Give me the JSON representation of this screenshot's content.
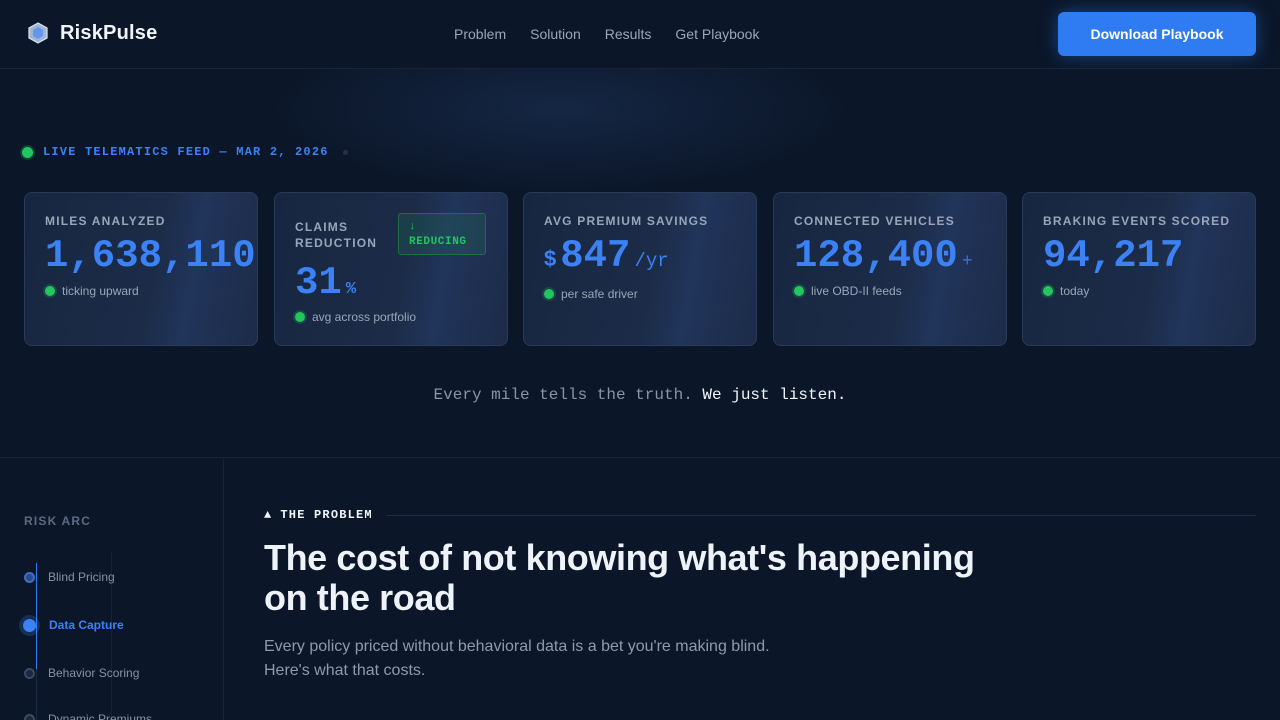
{
  "header": {
    "brand": "RiskPulse",
    "nav": [
      "Problem",
      "Solution",
      "Results",
      "Get Playbook"
    ],
    "cta": "Download Playbook"
  },
  "hero": {
    "feed": "LIVE TELEMATICS FEED — MAR 2, 2026",
    "cards": [
      {
        "label": "MILES ANALYZED",
        "value": "1,638,110",
        "foot": "ticking upward"
      },
      {
        "label_line1": "CLAIMS",
        "label_line2": "REDUCTION",
        "badge_arrow": "↓",
        "badge": "REDUCING",
        "value": "31",
        "unit": "%",
        "foot": "avg across portfolio"
      },
      {
        "label": "AVG PREMIUM SAVINGS",
        "prefix": "$",
        "value": "847",
        "unit": "/yr",
        "foot": "per safe driver"
      },
      {
        "label": "CONNECTED VEHICLES",
        "value": "128,400",
        "unit": "+",
        "foot": "live OBD-II feeds"
      },
      {
        "label": "BRAKING EVENTS SCORED",
        "value": "94,217",
        "foot": "today"
      }
    ],
    "tagline_a": "Every mile tells the truth.",
    "tagline_b": "We just listen."
  },
  "sidebar": {
    "title": "RISK ARC",
    "items": [
      "Blind Pricing",
      "Data Capture",
      "Behavior Scoring",
      "Dynamic Premiums"
    ]
  },
  "problem": {
    "eyebrow_icon": "▲",
    "eyebrow": "THE PROBLEM",
    "heading": "The cost of not knowing what's happening on the road",
    "lead_line1": "Every policy priced without behavioral data is a bet you're making blind.",
    "lead_line2": "Here's what that costs."
  },
  "colors": {
    "accent": "#3b82f6",
    "cta": "#2f7cf2",
    "live": "#22c55e",
    "bg": "#0b1628"
  }
}
